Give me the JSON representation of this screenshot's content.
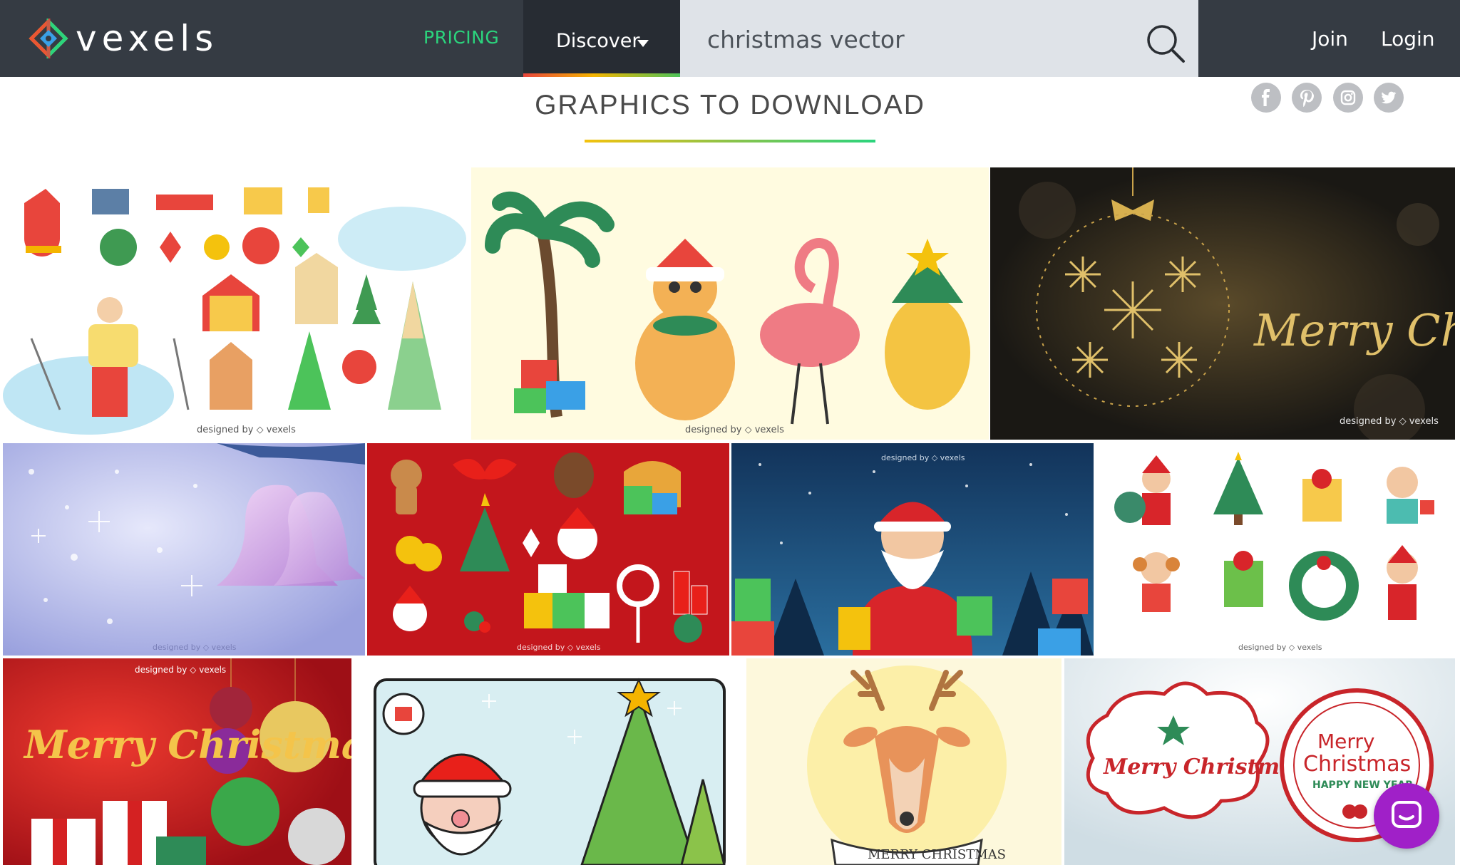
{
  "nav": {
    "brand": "vexels",
    "pricing_label": "PRICING",
    "discover_label": "Discover",
    "search_value": "christmas vector",
    "join_label": "Join",
    "login_label": "Login"
  },
  "headline": "GRAPHICS TO DOWNLOAD",
  "social": [
    "facebook-icon",
    "pinterest-icon",
    "instagram-icon",
    "twitter-icon"
  ],
  "tiles": [
    {
      "wm": "designed by ◇ vexels"
    },
    {
      "wm": "designed by ◇ vexels"
    },
    {
      "wm": "designed by ◇ vexels",
      "greeting": "Merry Christmas"
    },
    {
      "wm": "designed by ◇ vexels"
    },
    {
      "wm": "designed by ◇ vexels"
    },
    {
      "wm": "designed by ◇ vexels"
    },
    {
      "wm": "designed by ◇ vexels"
    },
    {
      "wm": "designed by ◇ vexels",
      "greeting": "Merry Christmas"
    },
    {
      "wm": ""
    },
    {
      "wm": "",
      "banner": "MERRY CHRISTMAS"
    },
    {
      "wm": "",
      "label1": "Merry Christmas",
      "label2": "Merry",
      "label3": "Christmas",
      "label4": "HAPPY NEW YEAR"
    }
  ],
  "colors": {
    "navbar": "#353b43",
    "discover": "#272c33",
    "pricing": "#2bd47d",
    "search_bg": "#dfe3e8",
    "chat": "#a020c8"
  }
}
